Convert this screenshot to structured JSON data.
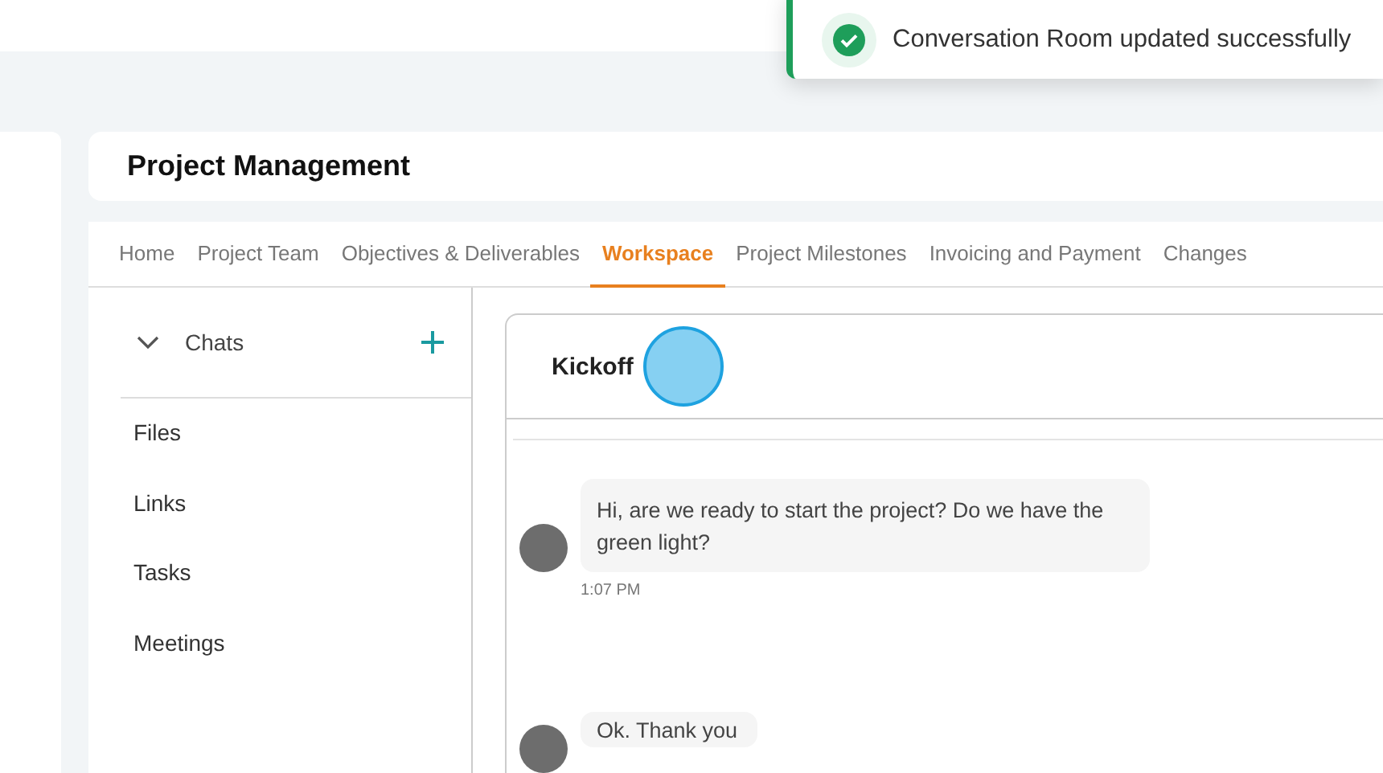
{
  "toast": {
    "message": "Conversation Room updated successfully",
    "kind": "success"
  },
  "page": {
    "title": "Project Management"
  },
  "tabs": [
    {
      "label": "Home",
      "selected": false
    },
    {
      "label": "Project Team",
      "selected": false
    },
    {
      "label": "Objectives & Deliverables",
      "selected": false
    },
    {
      "label": "Workspace",
      "selected": true
    },
    {
      "label": "Project Milestones",
      "selected": false
    },
    {
      "label": "Invoicing and Payment",
      "selected": false
    },
    {
      "label": "Changes",
      "selected": false
    }
  ],
  "sidebar": {
    "section": {
      "label": "Chats",
      "expanded": true
    },
    "items": [
      "Files",
      "Links",
      "Tasks",
      "Meetings"
    ]
  },
  "chat": {
    "title": "Kickoff",
    "messages": [
      {
        "text": "Hi, are we ready to start the project? Do we have the green light?",
        "time": "1:07 PM"
      },
      {
        "text": "Ok. Thank you"
      }
    ]
  }
}
